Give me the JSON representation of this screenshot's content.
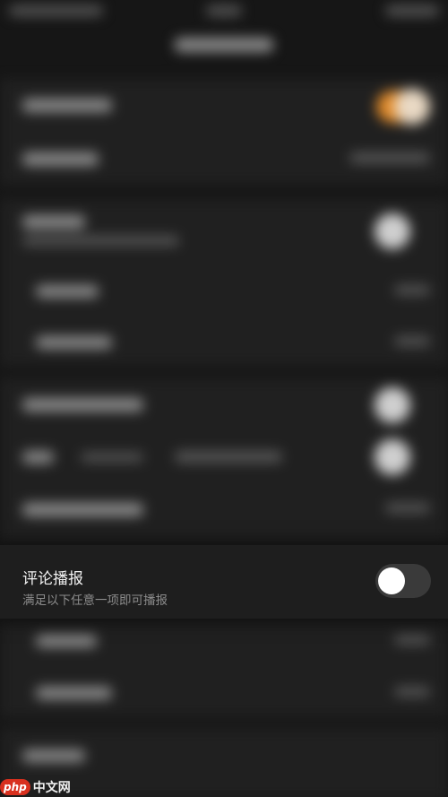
{
  "comment_broadcast": {
    "title": "评论播报",
    "subtitle": "满足以下任意一项即可播报",
    "enabled": false
  },
  "watermark": {
    "badge": "php",
    "text": "中文网"
  },
  "colors": {
    "background": "#161616",
    "row_background": "#1e1e1e",
    "title_text": "#f2f2f2",
    "subtitle_text": "#8c8c8c",
    "toggle_off": "#3a3a3a",
    "toggle_knob": "#ffffff",
    "accent_orange": "#e08a2a"
  }
}
